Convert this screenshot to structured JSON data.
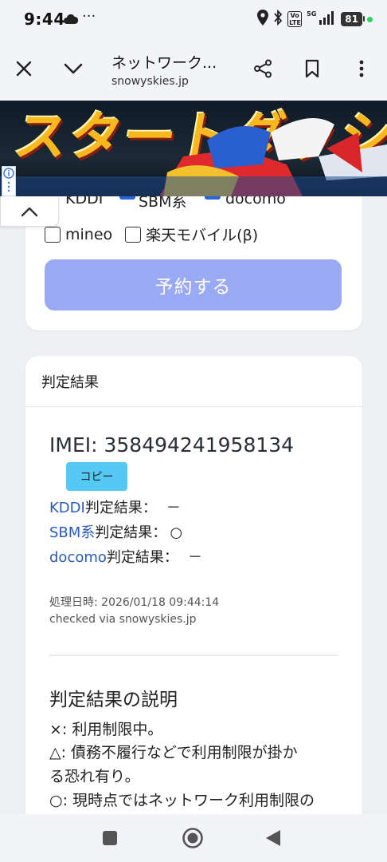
{
  "status_bar": {
    "time": "9:44",
    "dots": "···",
    "volte": "Vo LTE",
    "network": "5G",
    "battery": "81"
  },
  "header": {
    "title": "ネットワーク...",
    "domain": "snowyskies.jp"
  },
  "ad": {
    "headline": "スタートダッシュの"
  },
  "carriers": {
    "partial_row": [
      "KDDI",
      "SBM系",
      "docomo"
    ],
    "options": [
      {
        "label": "mineo",
        "checked": false
      },
      {
        "label": "楽天モバイル(β)",
        "checked": false
      }
    ],
    "reserve_button": "予約する"
  },
  "result": {
    "section_title": "判定結果",
    "imei": "IMEI: 358494241958134",
    "copy_button": "コピー",
    "lines": [
      {
        "carrier": "KDDI",
        "label": "判定結果：",
        "value": "－"
      },
      {
        "carrier": "SBM系",
        "label": "判定結果：",
        "value": "○"
      },
      {
        "carrier": "docomo",
        "label": "判定結果：",
        "value": "－"
      }
    ],
    "processed_at": "処理日時: 2026/01/18 09:44:14",
    "checked_via": "checked via snowyskies.jp"
  },
  "explanation": {
    "title": "判定結果の説明",
    "lines": [
      "×: 利用制限中。",
      "△: 債務不履行などで利用制限が掛か",
      "る恐れ有り。",
      "○: 現時点ではネットワーク利用制限の"
    ]
  },
  "colors": {
    "reserve_button": "#9aa9f3",
    "copy_button": "#55c8f5",
    "link": "#2a5cb8",
    "battery_dot": "#2bd463"
  }
}
